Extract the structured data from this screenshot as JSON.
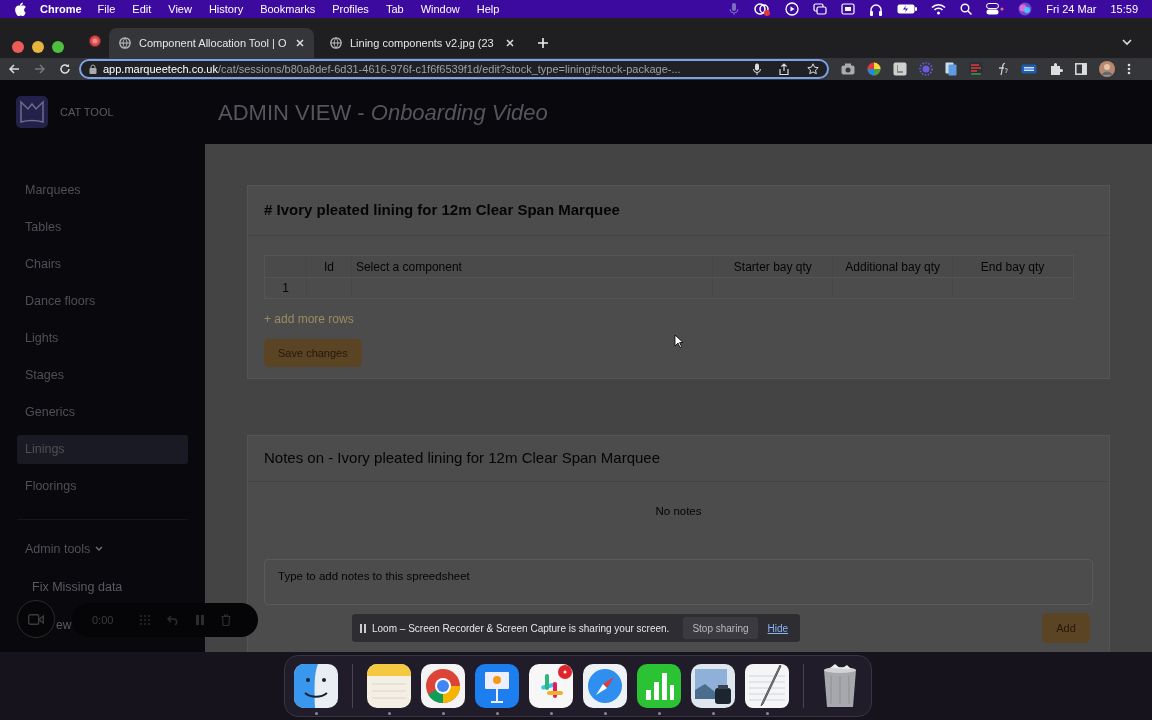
{
  "menu_bar": {
    "app": "Chrome",
    "items": [
      "File",
      "Edit",
      "View",
      "History",
      "Bookmarks",
      "Profiles",
      "Tab",
      "Window",
      "Help"
    ],
    "date": "Fri 24 Mar",
    "time": "15:59"
  },
  "browser": {
    "tabs": [
      {
        "title": "Component Allocation Tool | O",
        "selected": true
      },
      {
        "title": "Lining components v2.jpg (23",
        "selected": false
      }
    ],
    "url_host": "app.marqueetech.co.uk",
    "url_path": "/cat/sessions/b80a8def-6d31-4616-976f-c1f6f6539f1d/edit?stock_type=lining#stock-package-..."
  },
  "app": {
    "logo_text": "CAT TOOL",
    "title": "ADMIN VIEW - *Onboarding Video*"
  },
  "sidebar": {
    "items": [
      {
        "label": "Marquees",
        "selected": false
      },
      {
        "label": "Tables",
        "selected": false
      },
      {
        "label": "Chairs",
        "selected": false
      },
      {
        "label": "Dance floors",
        "selected": false
      },
      {
        "label": "Lights",
        "selected": false
      },
      {
        "label": "Stages",
        "selected": false
      },
      {
        "label": "Generics",
        "selected": false
      },
      {
        "label": "Linings",
        "selected": true
      },
      {
        "label": "Floorings",
        "selected": false
      }
    ],
    "admin_tools": {
      "label": "Admin tools",
      "expanded": true,
      "children": [
        "Fix Missing data",
        "ew"
      ]
    }
  },
  "package": {
    "title": "# Ivory pleated lining for 12m Clear Span Marquee",
    "columns": [
      "Id",
      "Select a component",
      "Starter bay qty",
      "Additional bay qty",
      "End bay qty"
    ],
    "rows": [
      "1"
    ],
    "add_rows": "+ add more rows",
    "save": "Save changes"
  },
  "notes": {
    "title": "Notes on - Ivory pleated lining for 12m Clear Span Marquee",
    "empty": "No notes",
    "placeholder": "Type to add notes to this spreedsheet",
    "add": "Add"
  },
  "loom": {
    "timer": "0:00",
    "banner": "Loom – Screen Recorder & Screen Capture is sharing your screen.",
    "stop": "Stop sharing",
    "hide": "Hide"
  },
  "dock": {
    "apps": [
      {
        "kind": "finder",
        "running": true
      },
      {
        "kind": "divider"
      },
      {
        "kind": "notes",
        "running": true
      },
      {
        "kind": "chrome",
        "running": true
      },
      {
        "kind": "keynote",
        "running": true
      },
      {
        "kind": "slack",
        "running": true
      },
      {
        "kind": "safari",
        "running": true
      },
      {
        "kind": "numbers",
        "running": true
      },
      {
        "kind": "preview",
        "running": true
      },
      {
        "kind": "textedit",
        "running": true
      },
      {
        "kind": "divider"
      },
      {
        "kind": "trash"
      }
    ]
  }
}
